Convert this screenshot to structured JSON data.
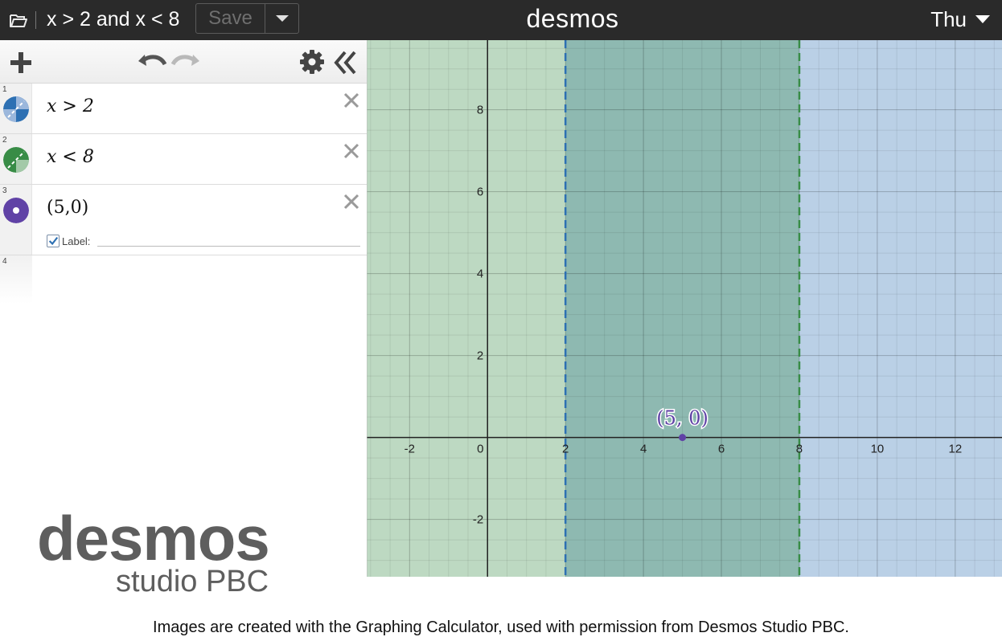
{
  "topbar": {
    "graph_title": "x > 2 and x < 8",
    "save_label": "Save",
    "brand": "desmos",
    "user_name": "Thu"
  },
  "expressions": [
    {
      "number": "1",
      "latex": "x > 2",
      "color": "#2d70b3"
    },
    {
      "number": "2",
      "latex": "x < 8",
      "color": "#388c46"
    },
    {
      "number": "3",
      "latex": "(5,0)",
      "color": "#6042a6",
      "label_checked": true,
      "label_text": "Label:"
    },
    {
      "number": "4"
    }
  ],
  "logo": {
    "line1": "desmos",
    "line2": "studio PBC"
  },
  "graph": {
    "x_ticks": [
      "-2",
      "0",
      "2",
      "4",
      "6",
      "8",
      "10",
      "12"
    ],
    "y_ticks": [
      "8",
      "6",
      "4",
      "2",
      "-2"
    ],
    "point_label": "(5, 0)",
    "colors": {
      "green_region": "#388c46",
      "blue_region": "#2d70b3",
      "point": "#6042a6"
    }
  },
  "chart_data": {
    "type": "scatter",
    "regions": [
      {
        "inequality": "x > 2",
        "boundary": 2,
        "style": "dashed",
        "color": "#2d70b3"
      },
      {
        "inequality": "x < 8",
        "boundary": 8,
        "style": "dashed",
        "color": "#388c46"
      }
    ],
    "points": [
      {
        "x": 5,
        "y": 0,
        "label": "(5, 0)",
        "color": "#6042a6"
      }
    ],
    "xlim": [
      -3.1,
      13.2
    ],
    "ylim": [
      -3.4,
      9.7
    ],
    "grid": true
  },
  "caption": "Images are created with the Graphing Calculator, used with permission from Desmos Studio PBC."
}
